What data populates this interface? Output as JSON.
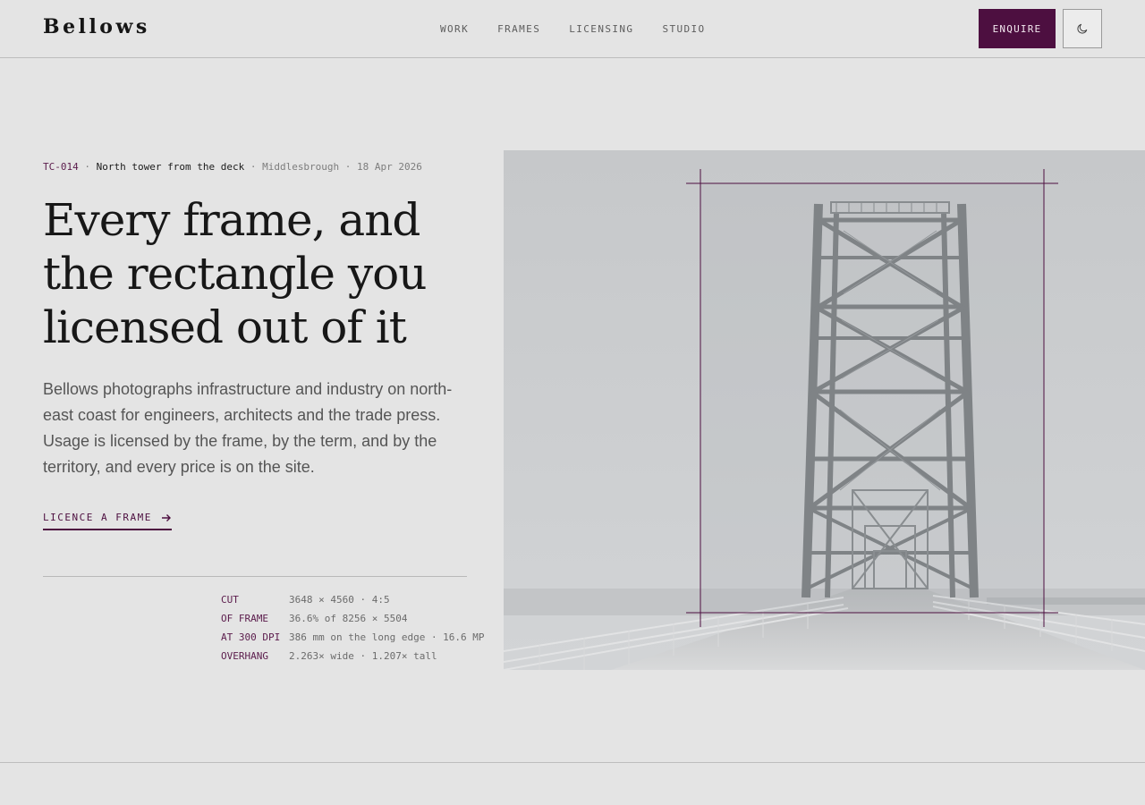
{
  "brand": {
    "name": "Bellows",
    "accent": "#4d0f40"
  },
  "nav": {
    "items": [
      "WORK",
      "FRAMES",
      "LICENSING",
      "STUDIO"
    ]
  },
  "header": {
    "enquire_label": "ENQUIRE",
    "theme_toggle_icon": "moon-icon"
  },
  "frame_meta": {
    "id": "TC-014",
    "title": "North tower from the deck",
    "location": "Middlesbrough",
    "date": "18 Apr 2026",
    "separator": "·"
  },
  "hero": {
    "headline": "Every frame, and the rectangle you licensed out of it",
    "lede": "Bellows photographs infrastructure and industry on north-east coast for engineers, architects and the trade press. Usage is licensed by the frame, by the term, and by the territory, and every price is on the site.",
    "cta_label": "LICENCE A FRAME",
    "cta_icon": "arrow-right-icon"
  },
  "specs": [
    {
      "key": "CUT",
      "value": "3648 × 4560 · 4:5"
    },
    {
      "key": "OF FRAME",
      "value": "36.6% of 8256 × 5504"
    },
    {
      "key": "AT 300 DPI",
      "value": "386 mm on the long edge · 16.6 MP"
    },
    {
      "key": "OVERHANG",
      "value": "2.263× wide · 1.207× tall"
    }
  ],
  "photo": {
    "subject": "bridge-tower-photo",
    "crop_ratio": "4:5"
  }
}
